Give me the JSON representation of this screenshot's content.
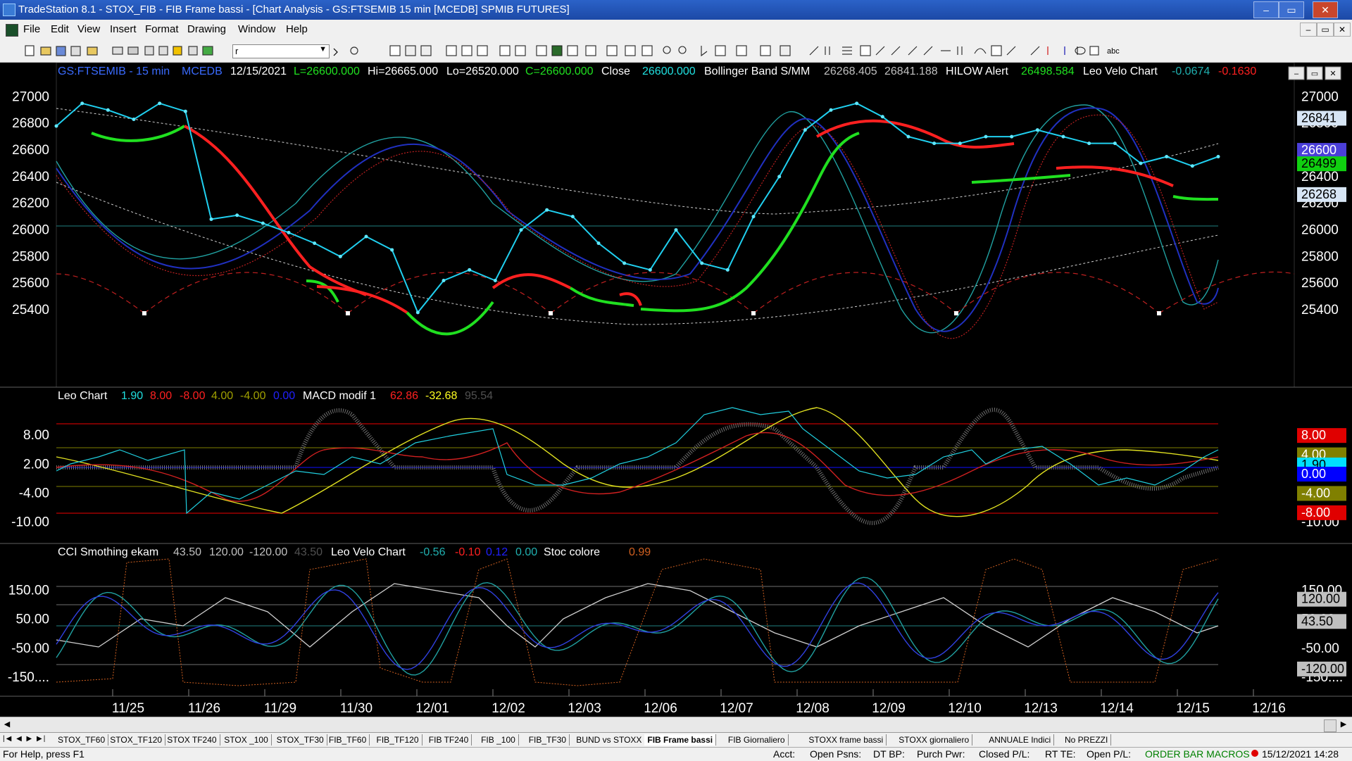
{
  "window": {
    "title": "TradeStation 8.1 - STOX_FIB - FIB Frame bassi - [Chart Analysis - GS:FTSEMIB  15 min  [MCEDB] SPMIB FUTURES]",
    "min": "–",
    "max": "▭",
    "close": "✕"
  },
  "menu": [
    "File",
    "Edit",
    "View",
    "Insert",
    "Format",
    "Drawing",
    "Window",
    "Help"
  ],
  "toolbar": {
    "symbol_value": "r"
  },
  "header": {
    "symbol": "GS:FTSEMIB - 15 min",
    "feed": "MCEDB",
    "date": "12/15/2021",
    "last": "L=26600.000",
    "hi": "Hi=26665.000",
    "lo": "Lo=26520.000",
    "close_val": "C=26600.000",
    "close_label": "Close",
    "close_num": "26600.000",
    "bb_label": "Bollinger Band S/MM",
    "bb1": "26268.405",
    "bb2": "26841.188",
    "hilow_label": "HILOW Alert",
    "hilow_val": "26498.584",
    "leovelo_label": "Leo Velo Chart",
    "lv1": "-0.0674",
    "lv2": "-0.1630"
  },
  "panel2": {
    "label": "Leo Chart",
    "v1": "1.90",
    "v2": "8.00",
    "v3": "-8.00",
    "v4": "4.00",
    "v5": "-4.00",
    "v6": "0.00",
    "macd_label": "MACD modif 1",
    "m1": "62.86",
    "m2": "-32.68",
    "m3": "95.54"
  },
  "panel3": {
    "label": "CCI Smothing ekam",
    "c1": "43.50",
    "c2": "120.00",
    "c3": "-120.00",
    "c4": "43.50",
    "leovelo_label": "Leo Velo Chart",
    "l1": "-0.56",
    "l2": "-0.10",
    "l3": "0.12",
    "l4": "0.00",
    "stoc_label": "Stoc colore",
    "s1": "0.99"
  },
  "chart_data": [
    {
      "type": "line",
      "title": "GS:FTSEMIB - 15 min",
      "x": [
        "11/25",
        "11/26",
        "11/29",
        "11/30",
        "12/01",
        "12/02",
        "12/03",
        "12/06",
        "12/07",
        "12/08",
        "12/09",
        "12/10",
        "12/13",
        "12/14",
        "12/15",
        "12/16"
      ],
      "ylim": [
        25300,
        27150
      ],
      "y_ticks": [
        "27000",
        "26800",
        "26600",
        "26400",
        "26200",
        "26000",
        "25800",
        "25600",
        "25400"
      ],
      "price_series": [
        26780,
        26950,
        26900,
        26830,
        26950,
        26890,
        26080,
        26110,
        26050,
        25980,
        25900,
        25800,
        25950,
        25850,
        25380,
        25620,
        25700,
        25620,
        26000,
        26150,
        26100,
        25900,
        25750,
        25700,
        26000,
        25750,
        25700,
        26100,
        26400,
        26750,
        26900,
        26950,
        26850,
        26700,
        26650,
        26650,
        26700,
        26700,
        26750,
        26700,
        26650,
        26650,
        26500,
        26550,
        26480,
        26550
      ],
      "axis_tags": [
        {
          "label": "26841",
          "color": "#d7e5f5",
          "value": 26841
        },
        {
          "label": "26600",
          "color": "#4b3fd8",
          "value": 26600
        },
        {
          "label": "26499",
          "color": "#10d010",
          "value": 26499
        },
        {
          "label": "26268",
          "color": "#d7e5f5",
          "value": 26268
        }
      ]
    },
    {
      "type": "line",
      "title": "Leo Chart",
      "ylim": [
        -14,
        14
      ],
      "y_ticks": [
        "8.00",
        "2.00",
        "-4.00",
        "-10.00"
      ],
      "axis_tags": [
        {
          "label": "8.00",
          "color": "#e00000",
          "value": 8
        },
        {
          "label": "4.00",
          "color": "#808000",
          "value": 4
        },
        {
          "label": "1.90",
          "color": "#00e0ff",
          "value": 1.9
        },
        {
          "label": "0.00",
          "color": "#0000ff",
          "value": 0
        },
        {
          "label": "-4.00",
          "color": "#808000",
          "value": -4
        },
        {
          "label": "-8.00",
          "color": "#e00000",
          "value": -8
        }
      ]
    },
    {
      "type": "line",
      "title": "CCI Smothing ekam",
      "ylim": [
        -210,
        250
      ],
      "y_ticks": [
        "150.00",
        "50.00",
        "-50.00",
        "-150...."
      ],
      "axis_tags": [
        {
          "label": "120.00",
          "color": "#c0c0c0",
          "value": 120
        },
        {
          "label": "43.50",
          "color": "#c0c0c0",
          "value": 43.5
        },
        {
          "label": "-120.00",
          "color": "#c0c0c0",
          "value": -120
        }
      ]
    }
  ],
  "tabs": [
    "STOX_TF60",
    "STOX_TF120",
    "STOX TF240",
    "STOX _100",
    "STOX_TF30",
    "FIB_TF60",
    "FIB_TF120",
    "FIB TF240",
    "FIB _100",
    "FIB_TF30",
    "BUND vs STOXX",
    "FIB Frame bassi",
    "FIB Giornaliero",
    "STOXX frame bassi",
    "STOXX giornaliero",
    "ANNUALE Indici",
    "No PREZZI"
  ],
  "active_tab": "FIB Frame bassi",
  "status": {
    "help": "For Help, press F1",
    "acct": "Acct:",
    "open_psns": "Open Psns:",
    "dt_bp": "DT BP:",
    "purch_pwr": "Purch Pwr:",
    "closed_pl": "Closed P/L:",
    "rt_te": "RT TE:",
    "open_pl": "Open P/L:",
    "macros": "ORDER BAR  MACROS",
    "datetime": "15/12/2021 14:28"
  }
}
